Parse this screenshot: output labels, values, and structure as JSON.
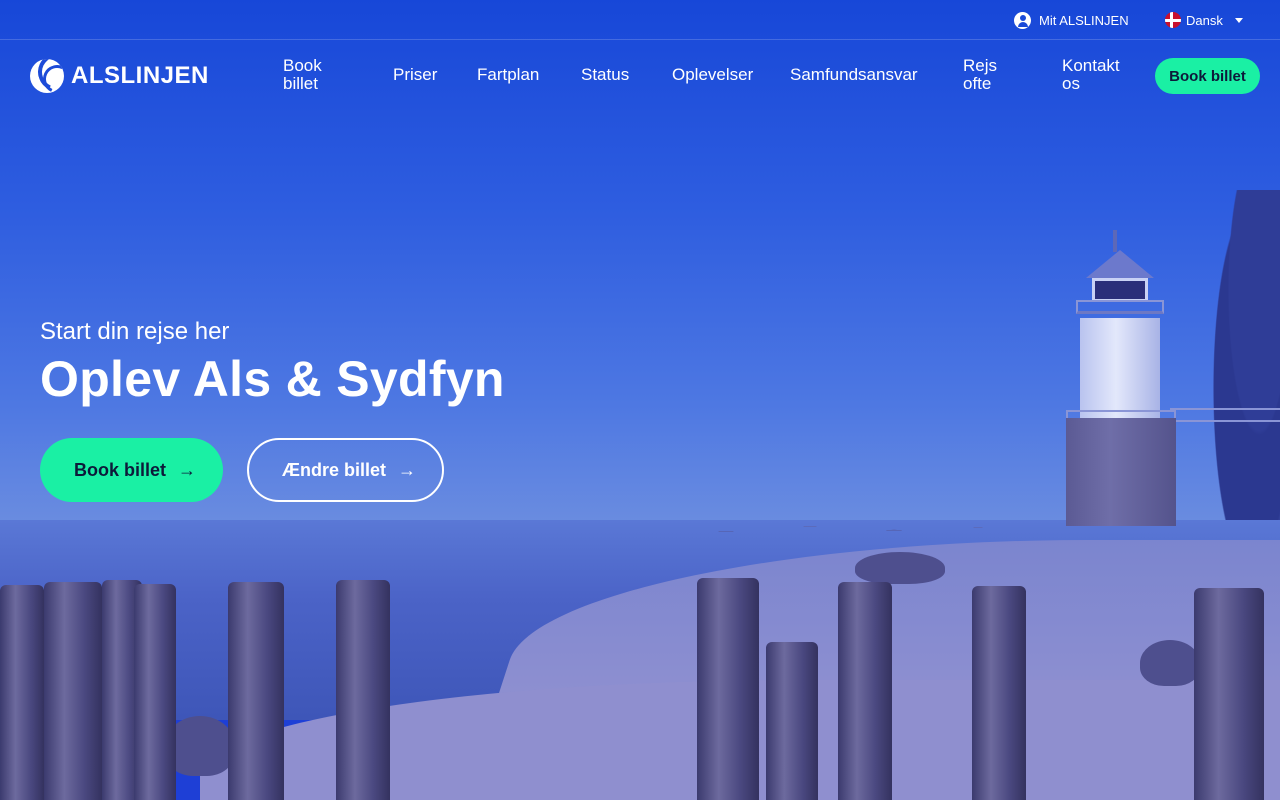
{
  "topbar": {
    "account_label": "Mit ALSLINJEN",
    "language_label": "Dansk"
  },
  "brand": {
    "name": "ALSLINJEN"
  },
  "nav": {
    "items": [
      {
        "label": "Book billet"
      },
      {
        "label": "Priser"
      },
      {
        "label": "Fartplan"
      },
      {
        "label": "Status"
      },
      {
        "label": "Oplevelser"
      },
      {
        "label": "Samfundsansvar"
      },
      {
        "label": "Rejs ofte"
      },
      {
        "label": "Kontakt os"
      }
    ],
    "cta_label": "Book billet"
  },
  "hero": {
    "subtitle": "Start din rejse her",
    "headline": "Oplev Als & Sydfyn",
    "primary_cta": "Book billet",
    "secondary_cta": "Ændre billet",
    "arrow": "→"
  },
  "colors": {
    "accent": "#1af0a4",
    "overlay_blue": "#1e3fd6",
    "dark_text": "#0d1a3a"
  },
  "icons": {
    "account": "account-circle-icon",
    "flag": "flag-denmark-icon",
    "caret": "chevron-down-icon",
    "arrow": "arrow-right-icon"
  }
}
